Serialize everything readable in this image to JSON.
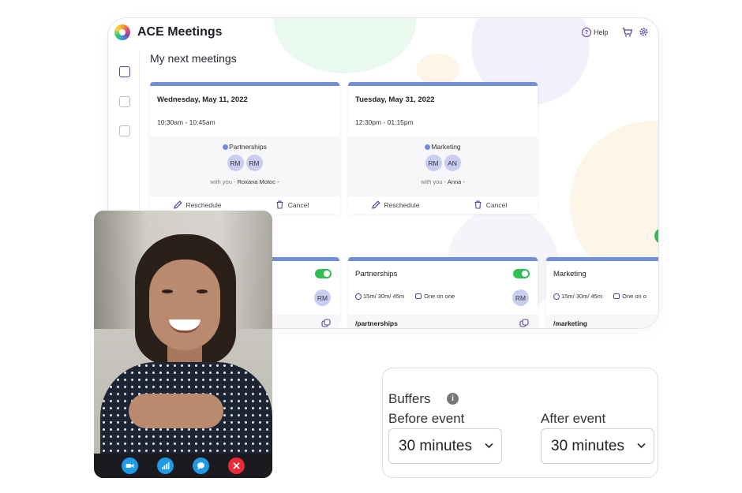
{
  "app": {
    "title": "ACE Meetings",
    "help_label": "Help",
    "section_title": "My next meetings"
  },
  "meetings": [
    {
      "date": "Wednesday, May 11, 2022",
      "time": "10:30am - 10:45am",
      "category": "Partnerships",
      "avatars": [
        "RM",
        "RM"
      ],
      "with_prefix": "with you -",
      "with_name": "Roxana Motoc -",
      "reschedule": "Reschedule",
      "cancel": "Cancel"
    },
    {
      "date": "Tuesday, May 31, 2022",
      "time": "12:30pm - 01:15pm",
      "category": "Marketing",
      "avatars": [
        "RM",
        "AN"
      ],
      "with_prefix": "with you -",
      "with_name": "Anna -",
      "reschedule": "Reschedule",
      "cancel": "Cancel"
    }
  ],
  "event_types": [
    {
      "name": "",
      "avatar": "RM",
      "durations": "",
      "format": "",
      "slug": ""
    },
    {
      "name": "Partnerships",
      "avatar": "RM",
      "durations": "15m/ 30m/ 45m",
      "format": "One on one",
      "slug": "/partnerships"
    },
    {
      "name": "Marketing",
      "avatar": "",
      "durations": "15m/ 30m/ 45m",
      "format": "One on o",
      "slug": "/marketing"
    }
  ],
  "buffers": {
    "title": "Buffers",
    "info": "i",
    "before_label": "Before event",
    "after_label": "After event",
    "before_value": "30 minutes",
    "after_value": "30 minutes"
  },
  "colors": {
    "accent": "#5b3fa0",
    "card_top": "#6f8fd9",
    "toggle_on": "#2fbf55",
    "call_button": "#1e9be6",
    "end_call": "#ec2a35"
  },
  "icons": [
    "help-icon",
    "cart-icon",
    "gear-icon",
    "calendar-icon",
    "pencil-icon",
    "trash-icon",
    "clock-icon",
    "chat-icon",
    "copy-icon",
    "video-icon",
    "signal-icon",
    "chat-bubble-icon",
    "end-call-icon",
    "info-icon",
    "chevron-down-icon"
  ]
}
